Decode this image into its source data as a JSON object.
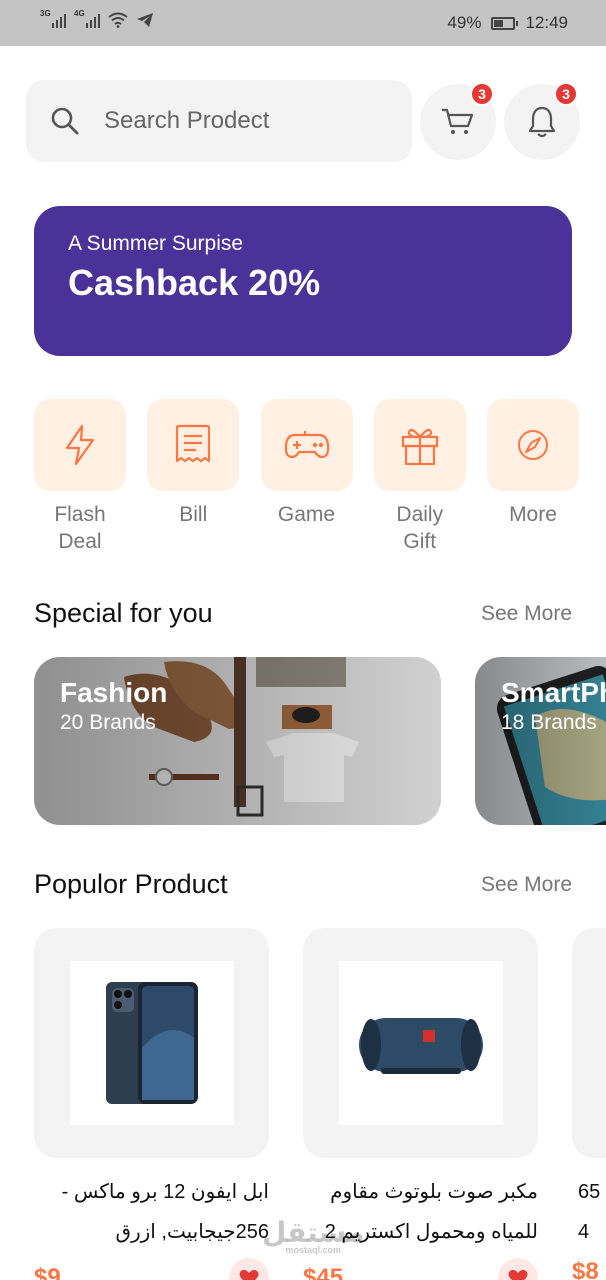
{
  "status_bar": {
    "network_left": "3G",
    "network_right": "4G",
    "battery": "49%",
    "time": "12:49",
    "battery_level": 0.49
  },
  "search": {
    "placeholder": "Search Prodect"
  },
  "header": {
    "cart_badge": "3",
    "notification_badge": "3"
  },
  "banner": {
    "subtitle": "A Summer Surpise",
    "title": "Cashback 20%"
  },
  "categories": [
    {
      "label": "Flash\nDeal",
      "icon": "flash-icon"
    },
    {
      "label": "Bill",
      "icon": "bill-icon"
    },
    {
      "label": "Game",
      "icon": "game-icon"
    },
    {
      "label": "Daily\nGift",
      "icon": "gift-icon"
    },
    {
      "label": "More",
      "icon": "discover-icon"
    }
  ],
  "special_section": {
    "title": "Special for you",
    "see_more": "See More",
    "cards": [
      {
        "title": "Fashion",
        "count": "20 Brands"
      },
      {
        "title": "SmartPh",
        "count": "18 Brands"
      }
    ]
  },
  "popular_section": {
    "title": "Populor  Product",
    "see_more": "See More",
    "products": [
      {
        "name_line1": "ابل ايفون 12 برو ماكس -",
        "name_line2": "256جيجابيت, ازرق",
        "price": "$9"
      },
      {
        "name_line1": "مكبر صوت بلوتوث مقاوم",
        "name_line2": "للمياه ومحمول اكستريم 2",
        "price": "$45"
      },
      {
        "name_line1": "65",
        "name_line2": "4",
        "price": "$8"
      }
    ]
  },
  "watermark": {
    "text": "مستقل",
    "sub": "mostaql.com"
  },
  "colors": {
    "accent": "#ff7643",
    "banner": "#4a3299",
    "badge": "#e53935"
  }
}
